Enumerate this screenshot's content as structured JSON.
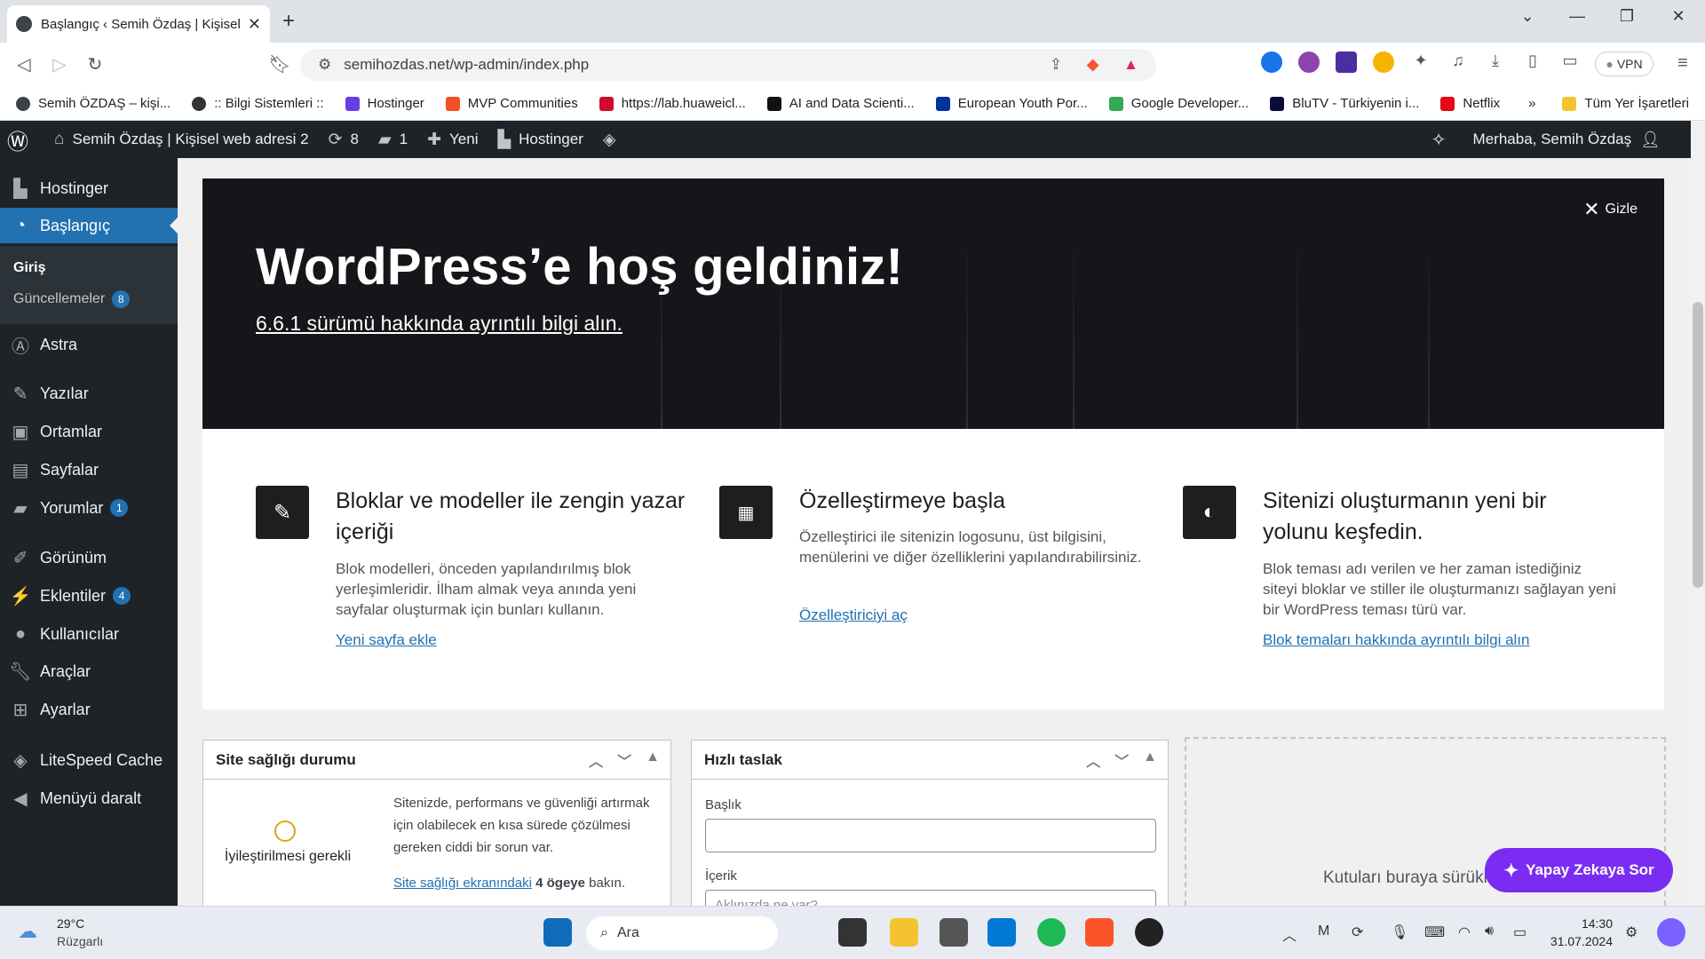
{
  "browser": {
    "tab_title": "Başlangıç ‹ Semih Özdaş | Kişisel",
    "url": "semihozdas.net/wp-admin/index.php",
    "vpn_label": "VPN",
    "bookmarks": [
      {
        "label": "Semih ÖZDAŞ – kişi...",
        "color": "#3c434a"
      },
      {
        "label": ":: Bilgi Sistemleri ::",
        "color": "#333333"
      },
      {
        "label": "Hostinger",
        "color": "#673de6"
      },
      {
        "label": "MVP Communities",
        "color": "#f25022"
      },
      {
        "label": "https://lab.huaweicl...",
        "color": "#cf0a2c"
      },
      {
        "label": "AI and Data Scienti...",
        "color": "#111111"
      },
      {
        "label": "European Youth Por...",
        "color": "#003399"
      },
      {
        "label": "Google Developer...",
        "color": "#34a853"
      },
      {
        "label": "BluTV - Türkiyenin i...",
        "color": "#0b0b3b"
      },
      {
        "label": "Netflix",
        "color": "#e50914"
      }
    ],
    "bookmarks_more": "»",
    "all_bookmarks": "Tüm Yer İşaretleri"
  },
  "adminbar": {
    "site_name": "Semih Özdaş | Kişisel web adresi 2",
    "updates_count": "8",
    "comments_count": "1",
    "new_label": "Yeni",
    "hostinger_label": "Hostinger",
    "greeting": "Merhaba, Semih Özdaş"
  },
  "sidebar": {
    "items": [
      {
        "label": "Hostinger",
        "icon": "hostinger-icon"
      },
      {
        "label": "Başlangıç",
        "icon": "dashboard-icon"
      },
      {
        "label": "Astra",
        "icon": "astra-icon"
      },
      {
        "label": "Yazılar",
        "icon": "pin-icon"
      },
      {
        "label": "Ortamlar",
        "icon": "media-icon"
      },
      {
        "label": "Sayfalar",
        "icon": "page-icon"
      },
      {
        "label": "Yorumlar",
        "icon": "comment-icon",
        "badge": "1"
      },
      {
        "label": "Görünüm",
        "icon": "brush-icon"
      },
      {
        "label": "Eklentiler",
        "icon": "plugin-icon",
        "badge": "4"
      },
      {
        "label": "Kullanıcılar",
        "icon": "user-icon"
      },
      {
        "label": "Araçlar",
        "icon": "wrench-icon"
      },
      {
        "label": "Ayarlar",
        "icon": "settings-icon"
      },
      {
        "label": "LiteSpeed Cache",
        "icon": "litespeed-icon"
      },
      {
        "label": "Menüyü daralt",
        "icon": "collapse-icon"
      }
    ],
    "submenu": {
      "home": "Giriş",
      "updates": "Güncellemeler",
      "updates_badge": "8"
    }
  },
  "welcome": {
    "title": "WordPress’e hoş geldiniz!",
    "version_link": "6.6.1 sürümü hakkında ayrıntılı bilgi alın.",
    "hide_label": "Gizle",
    "columns": [
      {
        "title": "Bloklar ve modeller ile zengin yazar içeriği",
        "text": "Blok modelleri, önceden yapılandırılmış blok yerleşimleridir. İlham almak veya anında yeni sayfalar oluşturmak için bunları kullanın.",
        "link": "Yeni sayfa ekle"
      },
      {
        "title": "Özelleştirmeye başla",
        "text": "Özelleştirici ile sitenizin logosunu, üst bilgisini, menülerini ve diğer özelliklerini yapılandırabilirsiniz.",
        "link": "Özelleştiriciyi aç"
      },
      {
        "title": "Sitenizi oluşturmanın yeni bir yolunu keşfedin.",
        "text": "Blok teması adı verilen ve her zaman istediğiniz siteyi bloklar ve stiller ile oluşturmanızı sağlayan yeni bir WordPress teması türü var.",
        "link": "Blok temaları hakkında ayrıntılı bilgi alın"
      }
    ]
  },
  "site_health": {
    "title": "Site sağlığı durumu",
    "status": "İyileştirilmesi gerekli",
    "text": "Sitenizde, performans ve güvenliği artırmak için olabilecek en kısa sürede çözülmesi gereken ciddi bir sorun var.",
    "link": "Site sağlığı ekranındaki",
    "link_suffix_bold": "4 ögeye",
    "link_suffix": "bakın."
  },
  "quick_draft": {
    "title": "Hızlı taslak",
    "title_label": "Başlık",
    "content_label": "İçerik",
    "content_placeholder": "Aklınızda ne var?"
  },
  "dropzone_text": "Kutuları buraya sürükleyin",
  "ai_button": "Yapay Zekaya Sor",
  "taskbar": {
    "weather_temp": "29°C",
    "weather_desc": "Rüzgarlı",
    "search_label": "Ara",
    "time": "14:30",
    "date": "31.07.2024"
  }
}
